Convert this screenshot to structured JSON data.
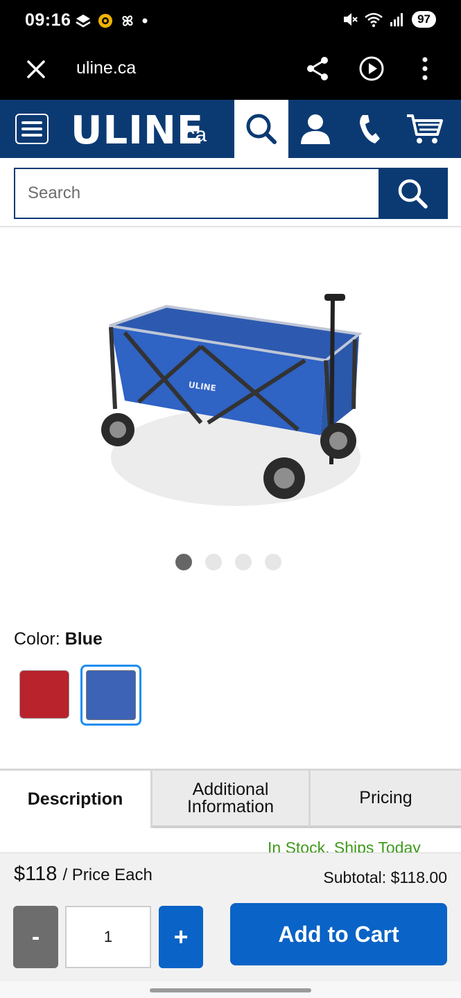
{
  "status_bar": {
    "time": "09:16",
    "battery": "97",
    "icons_left": [
      "notification-stack-icon",
      "soccer-ball-icon",
      "fan-icon",
      "dot-icon"
    ],
    "icons_right": [
      "mute-icon",
      "wifi-icon",
      "signal-icon"
    ]
  },
  "browser": {
    "url": "uline.ca",
    "icons": [
      "close-icon",
      "share-icon",
      "play-icon",
      "more-vertical-icon"
    ]
  },
  "header": {
    "logo": "ULINE",
    "logo_suffix": ".ca",
    "icons": [
      "menu-icon",
      "search-icon",
      "account-icon",
      "phone-icon",
      "cart-icon"
    ],
    "brand_color": "#0b3a73"
  },
  "search": {
    "placeholder": "Search",
    "value": ""
  },
  "gallery": {
    "image_name": "blue-folding-wagon",
    "slide_count": 4,
    "active_slide": 1
  },
  "color": {
    "label": "Color:",
    "selected": "Blue",
    "options": [
      {
        "name": "Red",
        "hex": "#b8232c"
      },
      {
        "name": "Blue",
        "hex": "#3c63b5"
      }
    ]
  },
  "tabs": [
    {
      "label": "Description",
      "active": true
    },
    {
      "label_line1": "Additional",
      "label_line2": "Information",
      "active": false
    },
    {
      "label": "Pricing",
      "active": false
    }
  ],
  "stock": {
    "text": "In Stock, Ships Today"
  },
  "purchase": {
    "price": "$118",
    "price_each": "/ Price Each",
    "subtotal": "Subtotal: $118.00",
    "minus": "-",
    "quantity": "1",
    "plus": "+",
    "add_to_cart": "Add to Cart",
    "accent_color": "#0a63c6"
  }
}
